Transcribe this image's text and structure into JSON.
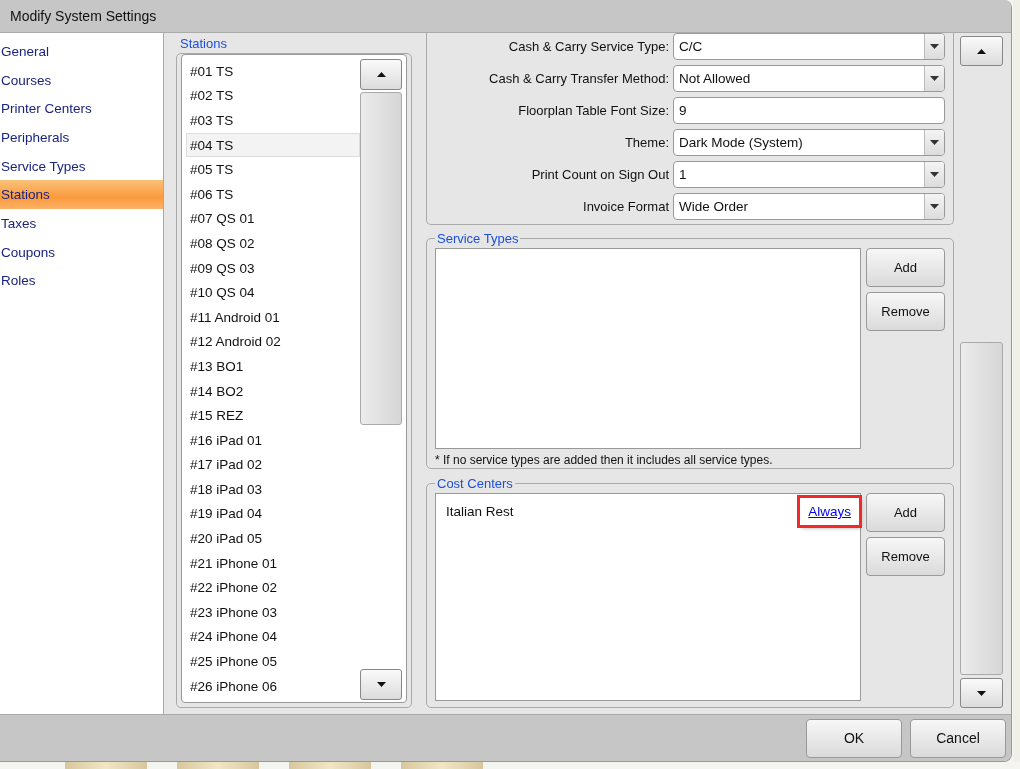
{
  "window": {
    "title": "Modify System Settings"
  },
  "sidebar": {
    "items": [
      {
        "label": "General",
        "selected": false
      },
      {
        "label": "Courses",
        "selected": false
      },
      {
        "label": "Printer Centers",
        "selected": false
      },
      {
        "label": "Peripherals",
        "selected": false
      },
      {
        "label": "Service Types",
        "selected": false
      },
      {
        "label": "Stations",
        "selected": true
      },
      {
        "label": "Taxes",
        "selected": false
      },
      {
        "label": "Coupons",
        "selected": false
      },
      {
        "label": "Roles",
        "selected": false
      }
    ]
  },
  "stations": {
    "title": "Stations",
    "items": [
      {
        "label": "#01 TS",
        "selected": false
      },
      {
        "label": "#02 TS",
        "selected": false
      },
      {
        "label": "#03 TS",
        "selected": false
      },
      {
        "label": "#04 TS",
        "selected": true
      },
      {
        "label": "#05 TS",
        "selected": false
      },
      {
        "label": "#06 TS",
        "selected": false
      },
      {
        "label": "#07 QS 01",
        "selected": false
      },
      {
        "label": "#08 QS 02",
        "selected": false
      },
      {
        "label": "#09 QS 03",
        "selected": false
      },
      {
        "label": "#10 QS 04",
        "selected": false
      },
      {
        "label": "#11 Android 01",
        "selected": false
      },
      {
        "label": "#12 Android 02",
        "selected": false
      },
      {
        "label": "#13 BO1",
        "selected": false
      },
      {
        "label": "#14 BO2",
        "selected": false
      },
      {
        "label": "#15 REZ",
        "selected": false
      },
      {
        "label": "#16 iPad 01",
        "selected": false
      },
      {
        "label": "#17 iPad 02",
        "selected": false
      },
      {
        "label": "#18 iPad 03",
        "selected": false
      },
      {
        "label": "#19 iPad 04",
        "selected": false
      },
      {
        "label": "#20 iPad 05",
        "selected": false
      },
      {
        "label": "#21 iPhone 01",
        "selected": false
      },
      {
        "label": "#22 iPhone 02",
        "selected": false
      },
      {
        "label": "#23 iPhone 03",
        "selected": false
      },
      {
        "label": "#24 iPhone 04",
        "selected": false
      },
      {
        "label": "#25 iPhone 05",
        "selected": false
      },
      {
        "label": "#26 iPhone 06",
        "selected": false
      }
    ]
  },
  "settings": [
    {
      "label": "Cash & Carry Service Type:",
      "kind": "dropdown",
      "value": "C/C"
    },
    {
      "label": "Cash & Carry Transfer Method:",
      "kind": "dropdown",
      "value": "Not Allowed"
    },
    {
      "label": "Floorplan Table Font Size:",
      "kind": "text",
      "value": "9"
    },
    {
      "label": "Theme:",
      "kind": "dropdown",
      "value": "Dark Mode (System)"
    },
    {
      "label": "Print Count on Sign Out",
      "kind": "dropdown",
      "value": "1"
    },
    {
      "label": "Invoice Format",
      "kind": "dropdown",
      "value": "Wide Order"
    }
  ],
  "service_types": {
    "title": "Service Types",
    "buttons": [
      "Add",
      "Remove"
    ],
    "note": "* If no service types are added then it includes all service types."
  },
  "cost_centers": {
    "title": "Cost Centers",
    "items": [
      {
        "name": "Italian Rest",
        "mode": "Always",
        "highlighted": true
      }
    ],
    "buttons": [
      "Add",
      "Remove"
    ]
  },
  "footer": {
    "buttons": [
      "OK",
      "Cancel"
    ]
  }
}
